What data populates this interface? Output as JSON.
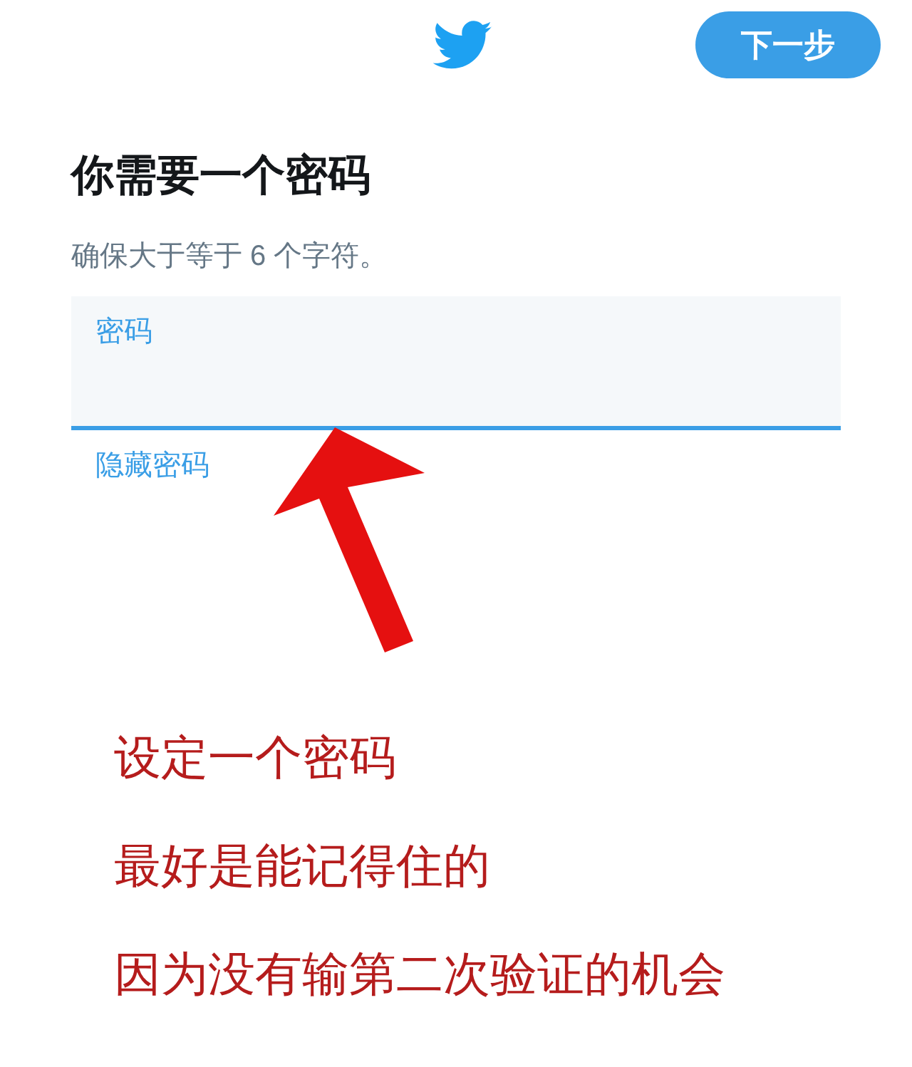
{
  "header": {
    "next_button": "下一步"
  },
  "title": "你需要一个密码",
  "subtitle": "确保大于等于 6 个字符。",
  "password_field": {
    "label": "密码",
    "focused": true
  },
  "toggle_link": "隐藏密码",
  "annotations": [
    "设定一个密码",
    "最好是能记得住的",
    "因为没有输第二次验证的机会"
  ]
}
